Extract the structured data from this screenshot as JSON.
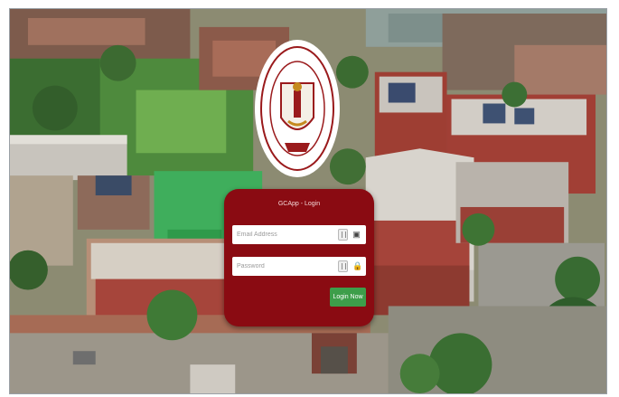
{
  "login": {
    "title": "GCApp - Login",
    "email_placeholder": "Email Address",
    "password_placeholder": "Password",
    "login_button": "Login Now",
    "email_icon": "id-card-icon",
    "password_icon": "lock-icon",
    "accent_color": "#8a0b12",
    "button_color": "#3d9e4a"
  },
  "background": {
    "description_icon": "campus-aerial-photo",
    "logo_icon": "college-emblem-logo"
  }
}
